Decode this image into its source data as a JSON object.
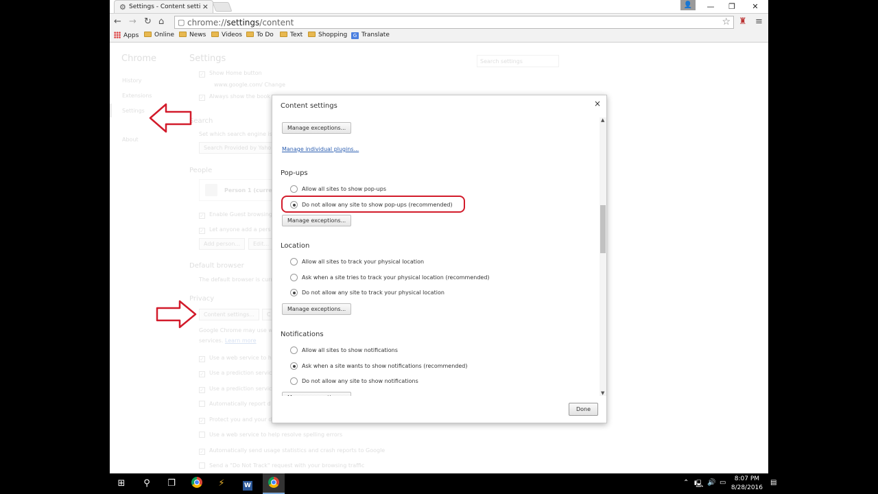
{
  "browser": {
    "tab_title": "Settings - Content settings",
    "tab_close": "×",
    "url_scheme": "chrome://",
    "url_path": "settings",
    "url_rest": "/content",
    "window_controls": {
      "minimize": "—",
      "restore": "❐",
      "close": "✕"
    }
  },
  "bookmarks": [
    {
      "label": "Apps",
      "icon": "apps-grid-icon"
    },
    {
      "label": "Online",
      "icon": "folder-icon"
    },
    {
      "label": "News",
      "icon": "folder-icon"
    },
    {
      "label": "Videos",
      "icon": "folder-icon"
    },
    {
      "label": "To Do",
      "icon": "folder-icon"
    },
    {
      "label": "Text",
      "icon": "folder-icon"
    },
    {
      "label": "Shopping",
      "icon": "folder-icon"
    },
    {
      "label": "Translate",
      "icon": "translate-icon"
    }
  ],
  "background": {
    "sidebar": {
      "heading": "Chrome",
      "items": [
        "History",
        "Extensions",
        "Settings",
        "About"
      ]
    },
    "title": "Settings",
    "search_placeholder": "Search settings",
    "show_home": "Show Home button",
    "home_url": "www.google.com/ Change",
    "always_show": "Always show the book",
    "search_heading": "Search",
    "search_desc": "Set which search engine is",
    "search_select": "Search Provided by Yaho",
    "people_heading": "People",
    "person": "Person 1 (curren",
    "guest": "Enable Guest browsing",
    "anyone": "Let anyone add a pers",
    "add_person": "Add person...",
    "edit": "Edit...",
    "default_heading": "Default browser",
    "default_desc": "The default browser is curr",
    "privacy_heading": "Privacy",
    "content_settings_btn": "Content settings...",
    "clear_btn": "C",
    "privacy_desc1": "Google Chrome may use w",
    "privacy_desc2": "services.",
    "learn_more": "Learn more",
    "privacy_items": [
      "Use a web service to he",
      "Use a prediction servic",
      "Use a prediction servic",
      "Automatically report d",
      "Protect you and your d",
      "Use a web service to help resolve spelling errors",
      "Automatically send usage statistics and crash reports to Google",
      "Send a \"Do Not Track\" request with your browsing traffic"
    ]
  },
  "dialog": {
    "title": "Content settings",
    "close": "×",
    "manage_exceptions": "Manage exceptions...",
    "manage_plugins": "Manage individual plugins...",
    "popups": {
      "heading": "Pop-ups",
      "options": [
        "Allow all sites to show pop-ups",
        "Do not allow any site to show pop-ups (recommended)"
      ],
      "selected": 1
    },
    "location": {
      "heading": "Location",
      "options": [
        "Allow all sites to track your physical location",
        "Ask when a site tries to track your physical location (recommended)",
        "Do not allow any site to track your physical location"
      ],
      "selected": 2
    },
    "notifications": {
      "heading": "Notifications",
      "options": [
        "Allow all sites to show notifications",
        "Ask when a site wants to show notifications (recommended)",
        "Do not allow any site to show notifications"
      ],
      "selected": 1
    },
    "done": "Done"
  },
  "taskbar": {
    "time": "8:07 PM",
    "date": "8/28/2016"
  },
  "colors": {
    "annotation_red": "#d21a2a",
    "link_blue": "#2a5db0"
  }
}
